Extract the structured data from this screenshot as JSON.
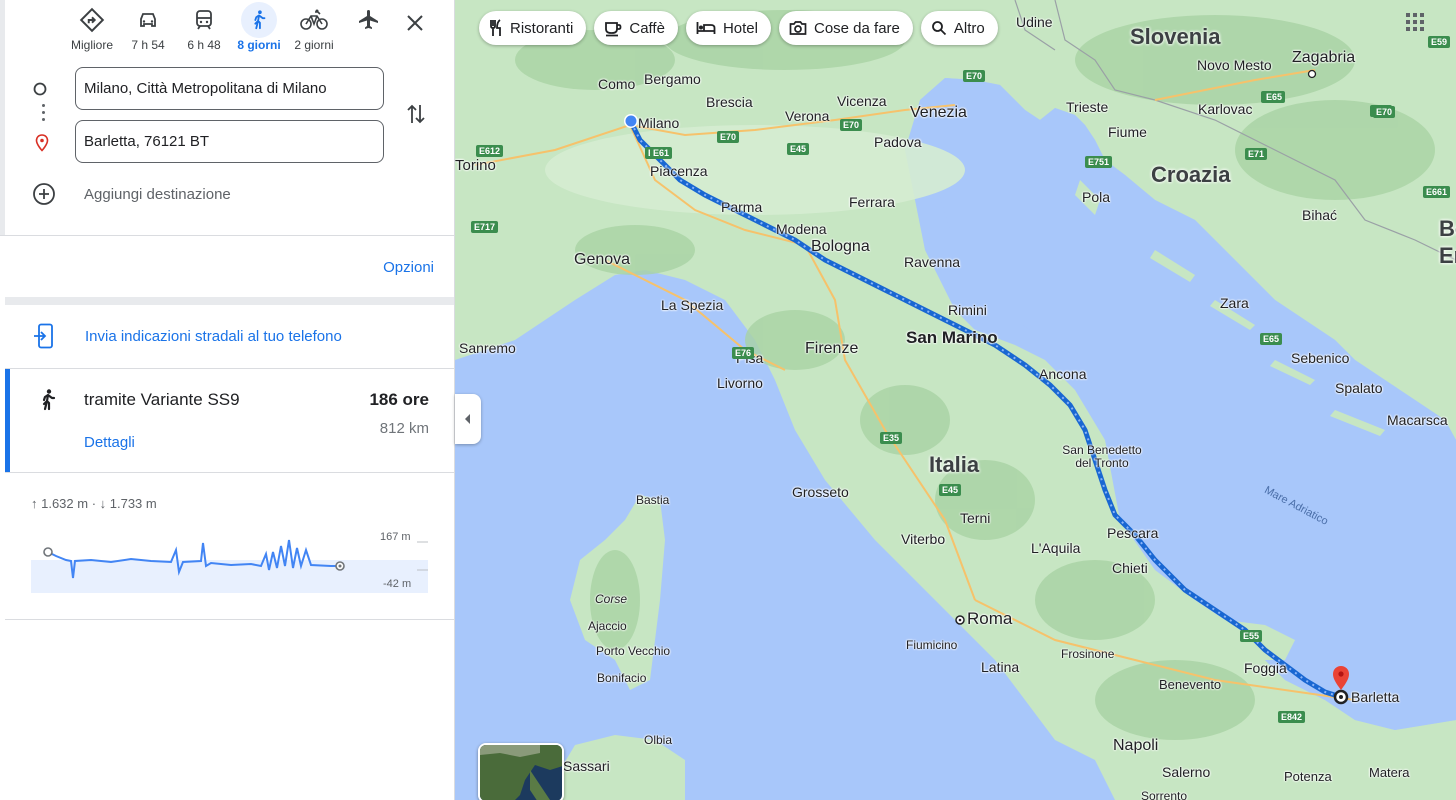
{
  "travel_modes": [
    {
      "icon": "best-route-icon",
      "label": "Migliore"
    },
    {
      "icon": "car-icon",
      "label": "7 h 54"
    },
    {
      "icon": "train-icon",
      "label": "6 h 48"
    },
    {
      "icon": "walk-icon",
      "label": "8 giorni",
      "active": true
    },
    {
      "icon": "bike-icon",
      "label": "2 giorni"
    },
    {
      "icon": "flight-icon",
      "label": ""
    }
  ],
  "origin": "Milano, Città Metropolitana di Milano",
  "destination": "Barletta, 76121 BT",
  "add_destination": "Aggiungi destinazione",
  "options_label": "Opzioni",
  "send_to_phone": "Invia indicazioni stradali al tuo telefono",
  "route": {
    "via": "tramite Variante SS9",
    "duration": "186 ore",
    "distance": "812 km",
    "details": "Dettagli"
  },
  "elevation": {
    "summary": "↑ 1.632 m · ↓ 1.733 m",
    "max": "167 m",
    "min": "-42 m"
  },
  "chips": [
    {
      "icon": "restaurant-icon",
      "label": "Ristoranti"
    },
    {
      "icon": "coffee-icon",
      "label": "Caffè"
    },
    {
      "icon": "hotel-icon",
      "label": "Hotel"
    },
    {
      "icon": "camera-icon",
      "label": "Cose da fare"
    },
    {
      "icon": "search-icon",
      "label": "Altro"
    }
  ],
  "map": {
    "countries": [
      "Slovenia",
      "Croazia",
      "Italia",
      "Bo",
      "Er"
    ],
    "sea": "Mare Adriatico",
    "cities": [
      "Udine",
      "Zagabria",
      "Novo Mesto",
      "Trieste",
      "Karlovac",
      "Como",
      "Bergamo",
      "Milano",
      "Brescia",
      "Vicenza",
      "Venezia",
      "Verona",
      "Padova",
      "Torino",
      "Piacenza",
      "Fiume",
      "Parma",
      "Ferrara",
      "Pola",
      "Modena",
      "Bologna",
      "Genova",
      "Ravenna",
      "Bihać",
      "Zara",
      "Rimini",
      "La Spezia",
      "San Marino",
      "Sanremo",
      "Pisa",
      "Firenze",
      "Sebenico",
      "Livorno",
      "Ancona",
      "Spalato",
      "Macarsca",
      "San Benedetto del Tronto",
      "Bastia",
      "Grosseto",
      "Italia",
      "Terni",
      "Viterbo",
      "L'Aquila",
      "Pescara",
      "Chieti",
      "Corse",
      "Ajaccio",
      "Roma",
      "Porto Vecchio",
      "Fiumicino",
      "Frosinone",
      "Latina",
      "Foggia",
      "Bonifacio",
      "Barletta",
      "Benevento",
      "Olbia",
      "Napoli",
      "Salerno",
      "Potenza",
      "Matera",
      "Sassari",
      "Sorrento"
    ],
    "road_labels": [
      "E59",
      "E65",
      "E70",
      "E61",
      "E64",
      "E612",
      "E717",
      "E70",
      "E45",
      "E751",
      "E71",
      "E661",
      "E35",
      "E76",
      "E35",
      "E45",
      "E55",
      "E842",
      "E65"
    ]
  }
}
